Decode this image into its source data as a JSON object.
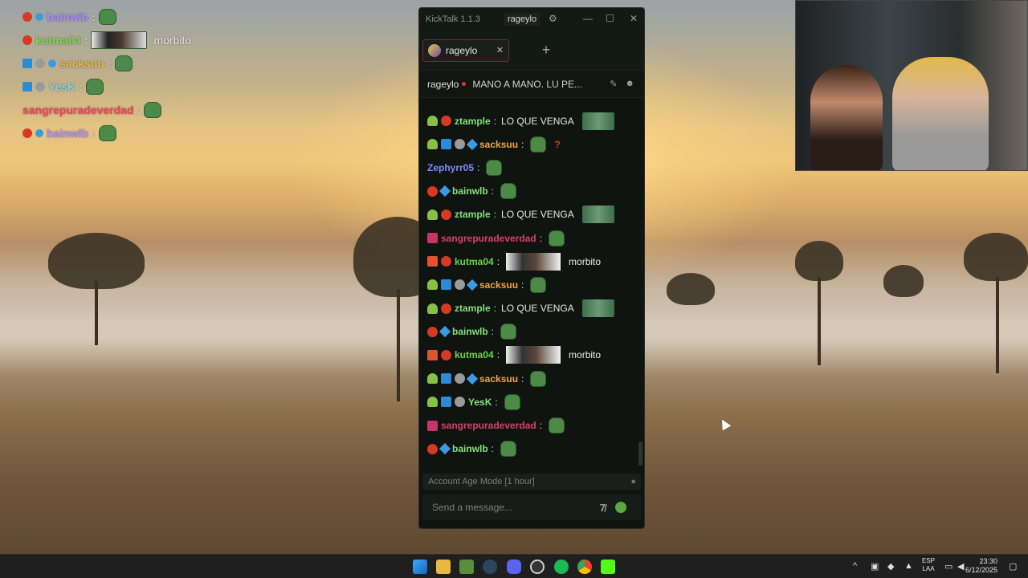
{
  "overlay": {
    "rows": [
      {
        "user": "bainwlb",
        "color": "#a98bff",
        "badges": [
          "red",
          "cube"
        ],
        "emote": "pepe"
      },
      {
        "user": "kutma04",
        "color": "#7bd84d",
        "badges": [
          "red-dark"
        ],
        "emote": "face",
        "text": "morbito"
      },
      {
        "user": "sacksuu",
        "color": "#e3b74c",
        "badges": [
          "hammer",
          "grey",
          "cube"
        ],
        "emote": "pepe"
      },
      {
        "user": "YesK",
        "color": "#8ad1e0",
        "badges": [
          "hammer",
          "grey"
        ],
        "emote": "pepe"
      },
      {
        "user": "sangrepuradeverdad",
        "color": "#f2445a",
        "badges": [],
        "emote": "pepe"
      },
      {
        "user": "bainwlb",
        "color": "#a98bff",
        "badges": [
          "red",
          "cube"
        ],
        "emote": "pepe"
      }
    ]
  },
  "window": {
    "app_title": "KickTalk 1.1.3",
    "current_user": "rageylo",
    "tab_label": "rageylo",
    "channel_name": "rageylo",
    "stream_title": "MANO A MANO. LU PE...",
    "age_mode_label": "Account Age Mode [1 hour]",
    "input_placeholder": "Send a message...",
    "kick_emote_label": "7̸"
  },
  "messages": [
    {
      "user": "ztample",
      "color": "#86e27a",
      "badges": [
        "sprout",
        "red"
      ],
      "text": "LO QUE VENGA",
      "emote": "wide"
    },
    {
      "user": "sacksuu",
      "color": "#f0a640",
      "badges": [
        "sprout",
        "hammer",
        "grey",
        "cube"
      ],
      "emote": "pepe",
      "extra": "?"
    },
    {
      "user": "Zephyrr05",
      "color": "#7f8cff",
      "badges": [],
      "emote": "pepe"
    },
    {
      "user": "bainwlb",
      "color": "#86e27a",
      "badges": [
        "red",
        "cube"
      ],
      "emote": "pepe"
    },
    {
      "user": "ztample",
      "color": "#86e27a",
      "badges": [
        "sprout",
        "red"
      ],
      "text": "LO QUE VENGA",
      "emote": "wide"
    },
    {
      "user": "sangrepuradeverdad",
      "color": "#d9416a",
      "badges": [
        "pink"
      ],
      "emote": "pepe"
    },
    {
      "user": "kutma04",
      "color": "#6fd44a",
      "badges": [
        "orange",
        "red"
      ],
      "emote": "face",
      "text2": "morbito"
    },
    {
      "user": "sacksuu",
      "color": "#f0a640",
      "badges": [
        "sprout",
        "hammer",
        "grey",
        "cube"
      ],
      "emote": "pepe"
    },
    {
      "user": "ztample",
      "color": "#86e27a",
      "badges": [
        "sprout",
        "red"
      ],
      "text": "LO QUE VENGA",
      "emote": "wide"
    },
    {
      "user": "bainwlb",
      "color": "#86e27a",
      "badges": [
        "red",
        "cube"
      ],
      "emote": "pepe"
    },
    {
      "user": "kutma04",
      "color": "#6fd44a",
      "badges": [
        "orange",
        "red"
      ],
      "emote": "face",
      "text2": "morbito"
    },
    {
      "user": "sacksuu",
      "color": "#f0a640",
      "badges": [
        "sprout",
        "hammer",
        "grey",
        "cube"
      ],
      "emote": "pepe"
    },
    {
      "user": "YesK",
      "color": "#86e27a",
      "badges": [
        "sprout",
        "hammer",
        "grey"
      ],
      "emote": "pepe"
    },
    {
      "user": "sangrepuradeverdad",
      "color": "#d9416a",
      "badges": [
        "pink"
      ],
      "emote": "pepe"
    },
    {
      "user": "bainwlb",
      "color": "#86e27a",
      "badges": [
        "red",
        "cube"
      ],
      "emote": "pepe"
    }
  ],
  "taskbar": {
    "lang_top": "ESP",
    "lang_bottom": "LAA",
    "time": "23:30",
    "date": "6/12/2025"
  }
}
